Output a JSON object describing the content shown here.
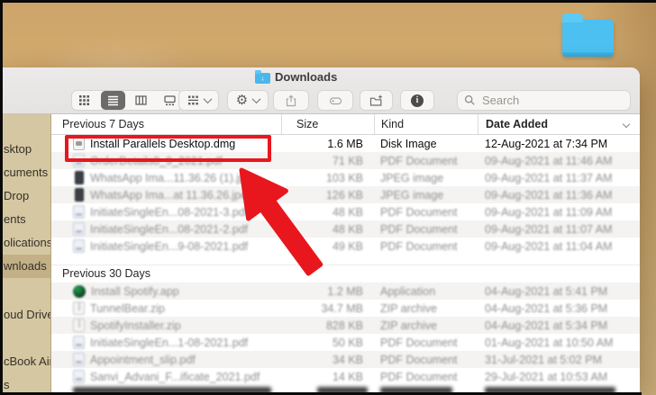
{
  "desktop": {
    "icons": [
      "blue-folder"
    ]
  },
  "window": {
    "title": "Downloads"
  },
  "toolbar": {
    "view_options": [
      "icon-view",
      "list-view",
      "column-view",
      "gallery-view"
    ],
    "selected_view": "list-view",
    "buttons": [
      "group-by",
      "actions",
      "share",
      "tags",
      "new-folder",
      "get-info"
    ],
    "search": {
      "placeholder": "Search"
    }
  },
  "sidebar": {
    "selected_item": "wnloads",
    "groups": [
      {
        "items": [
          {
            "label": "sktop"
          },
          {
            "label": "cuments"
          },
          {
            "label": "Drop"
          },
          {
            "label": "ents"
          },
          {
            "label": "olications"
          },
          {
            "label": "wnloads",
            "selected": true
          }
        ]
      },
      {
        "items": [
          {
            "label": "oud Drive"
          }
        ]
      },
      {
        "items": [
          {
            "label": "cBook Air"
          },
          {
            "label": "s"
          }
        ]
      }
    ]
  },
  "list": {
    "header": {
      "group_label": "Previous 7 Days",
      "size": "Size",
      "kind": "Kind",
      "date_added": "Date Added",
      "sorted_column": "Date Added"
    },
    "sections": [
      {
        "label": "Previous 7 Days",
        "rows": [
          {
            "name": "Install Parallels Desktop.dmg",
            "size": "1.6 MB",
            "kind": "Disk Image",
            "date": "12-Aug-2021 at 7:34 PM",
            "icon": "dmg",
            "highlighted": true
          },
          {
            "name": "OrderDetails8_9_2021.pdf",
            "size": "71 KB",
            "kind": "PDF Document",
            "date": "09-Aug-2021 at 11:46 AM",
            "icon": "pdf",
            "blurred": true
          },
          {
            "name": "WhatsApp Ima...11.36.26 (1).jpeg",
            "size": "103 KB",
            "kind": "JPEG image",
            "date": "09-Aug-2021 at 11:37 AM",
            "icon": "jpeg",
            "blurred": true
          },
          {
            "name": "WhatsApp Ima...at 11.36.26.jpeg",
            "size": "126 KB",
            "kind": "JPEG image",
            "date": "09-Aug-2021 at 11:36 AM",
            "icon": "jpeg",
            "blurred": true
          },
          {
            "name": "InitiateSingleEn...08-2021-3.pdf",
            "size": "48 KB",
            "kind": "PDF Document",
            "date": "09-Aug-2021 at 11:09 AM",
            "icon": "pdf",
            "blurred": true
          },
          {
            "name": "InitiateSingleEn...08-2021-2.pdf",
            "size": "48 KB",
            "kind": "PDF Document",
            "date": "09-Aug-2021 at 11:07 AM",
            "icon": "pdf",
            "blurred": true
          },
          {
            "name": "InitiateSingleEn...9-08-2021.pdf",
            "size": "49 KB",
            "kind": "PDF Document",
            "date": "09-Aug-2021 at 11:04 AM",
            "icon": "pdf",
            "blurred": true
          }
        ]
      },
      {
        "label": "Previous 30 Days",
        "rows": [
          {
            "name": "Install Spotify.app",
            "size": "1.2 MB",
            "kind": "Application",
            "date": "04-Aug-2021 at 5:41 PM",
            "icon": "app",
            "blurred": true
          },
          {
            "name": "TunnelBear.zip",
            "size": "34.7 MB",
            "kind": "ZIP archive",
            "date": "04-Aug-2021 at 5:36 PM",
            "icon": "zip",
            "blurred": true
          },
          {
            "name": "SpotifyInstaller.zip",
            "size": "828 KB",
            "kind": "ZIP archive",
            "date": "04-Aug-2021 at 5:34 PM",
            "icon": "zip",
            "blurred": true
          },
          {
            "name": "InitiateSingleEn...1-08-2021.pdf",
            "size": "50 KB",
            "kind": "PDF Document",
            "date": "01-Aug-2021 at 10:50 AM",
            "icon": "pdf",
            "blurred": true
          },
          {
            "name": "Appointment_slip.pdf",
            "size": "34 KB",
            "kind": "PDF Document",
            "date": "31-Jul-2021 at 5:02 PM",
            "icon": "pdf",
            "blurred": true
          },
          {
            "name": "Sanvi_Advani_F...ificate_2021.pdf",
            "size": "14 KB",
            "kind": "PDF Document",
            "date": "29-Jul-2021 at 10:53 AM",
            "icon": "pdf",
            "blurred": true
          }
        ]
      }
    ]
  },
  "annotations": {
    "color": "#e8171e",
    "highlighted_row": "Install Parallels Desktop.dmg"
  }
}
